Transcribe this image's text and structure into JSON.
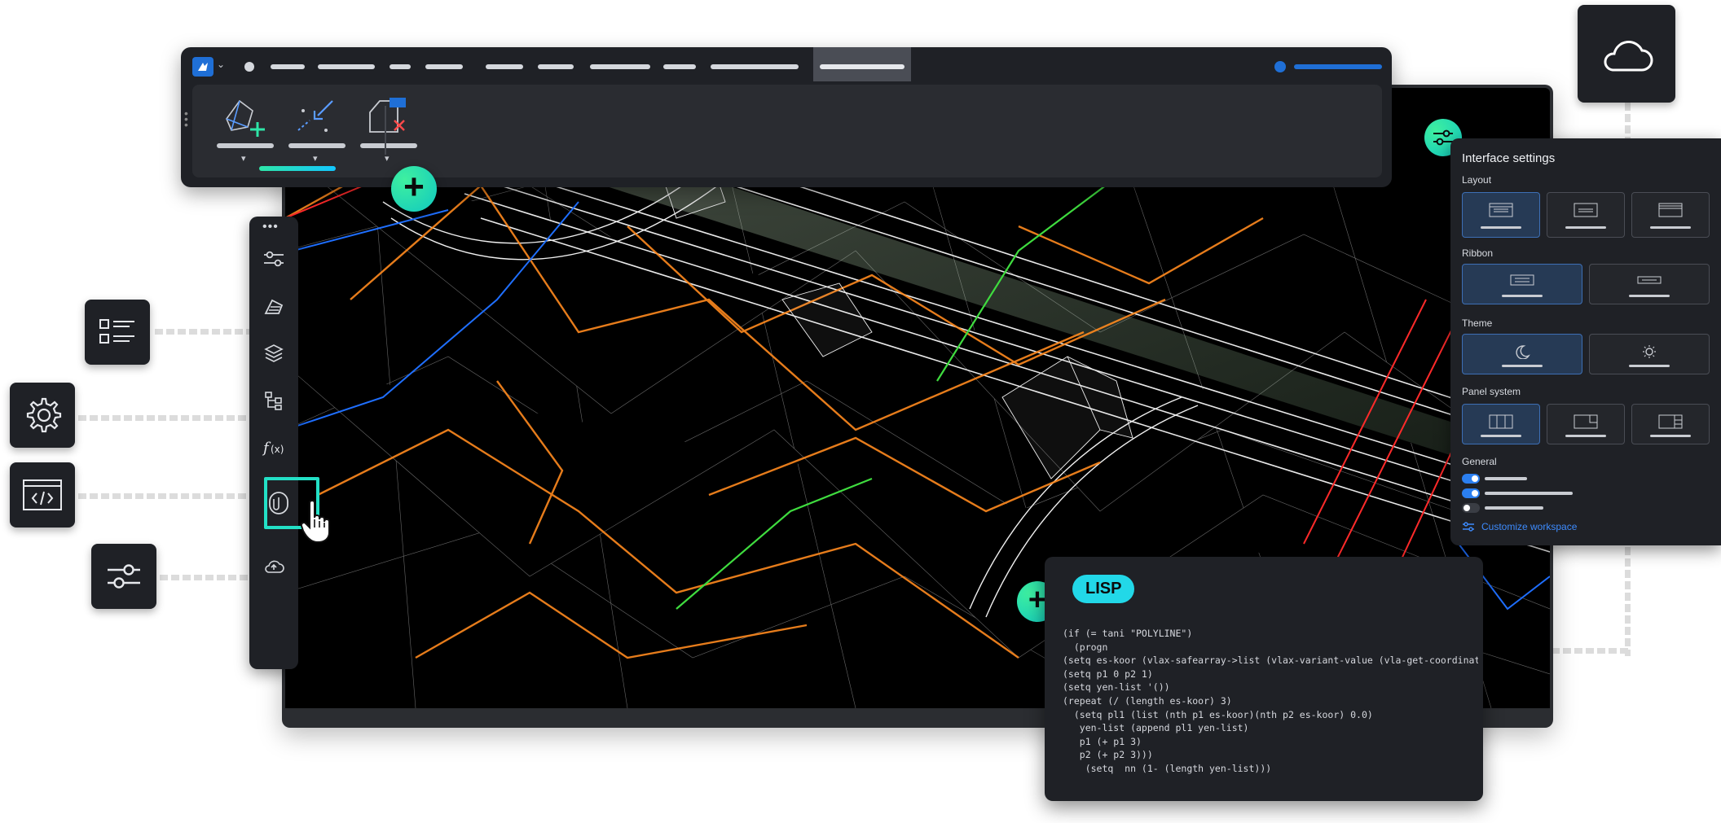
{
  "app": {
    "logo_icon": "app-logo-icon",
    "menu_items_count": 12
  },
  "ribbon": {
    "tools": [
      {
        "name": "add-point-tool",
        "icon": "mesh-add-icon"
      },
      {
        "name": "snap-tool",
        "icon": "snap-arrow-icon",
        "active": true
      },
      {
        "name": "remove-tool",
        "icon": "shape-remove-icon"
      }
    ]
  },
  "palette": {
    "items": [
      {
        "name": "sliders-icon"
      },
      {
        "name": "properties-icon"
      },
      {
        "name": "layers-icon"
      },
      {
        "name": "structure-icon"
      },
      {
        "name": "formula-icon"
      },
      {
        "name": "attachment-icon",
        "active": true
      },
      {
        "name": "cloud-upload-icon"
      }
    ]
  },
  "settings": {
    "title": "Interface settings",
    "sections": {
      "layout": "Layout",
      "ribbon": "Ribbon",
      "theme": "Theme",
      "panel_system": "Panel system",
      "general": "General"
    },
    "customize_label": "Customize workspace"
  },
  "lisp": {
    "badge": "LISP",
    "code": [
      "(if (= tani \"POLYLINE\")",
      "  (progn",
      "(setq es-koor (vlax-safearray->list (vlax-variant-value (vla-get-coordinates d",
      "(setq p1 0 p2 1)",
      "(setq yen-list '())",
      "(repeat (/ (length es-koor) 3)",
      "  (setq pl1 (list (nth p1 es-koor)(nth p2 es-koor) 0.0)",
      "   yen-list (append pl1 yen-list)",
      "   p1 (+ p1 3)",
      "   p2 (+ p2 3)))",
      "    (setq  nn (1- (length yen-list)))"
    ]
  },
  "colors": {
    "accent_green": "#2ee6a8",
    "accent_cyan": "#13c7ff",
    "brand_blue": "#1f6fd6",
    "panel_dark": "#1f2126"
  }
}
